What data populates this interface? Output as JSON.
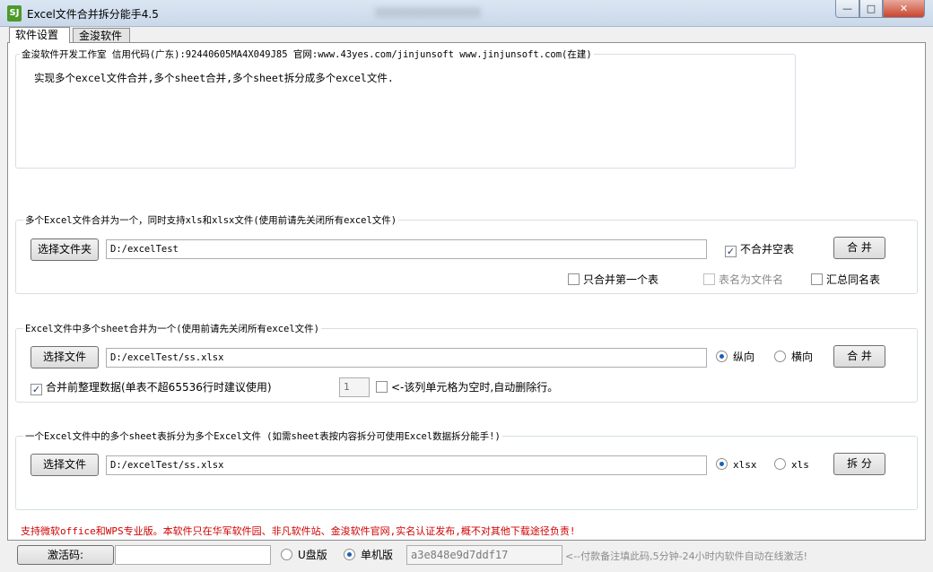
{
  "window": {
    "title": "Excel文件合并拆分能手4.5",
    "icon_text": "SJ",
    "min_symbol": "—",
    "max_symbol": "□",
    "close_symbol": "✕"
  },
  "tabs": [
    {
      "label": "软件设置",
      "active": true
    },
    {
      "label": "金浚软件",
      "active": false
    }
  ],
  "info": {
    "header": "金浚软件开发工作室 信用代码(广东):92440605MA4X049J85 官网:www.43yes.com/jinjunsoft  www.jinjunsoft.com(在建)",
    "description": "实现多个excel文件合并,多个sheet合并,多个sheet拆分成多个excel文件."
  },
  "merge_files": {
    "title": "多个Excel文件合并为一个，同时支持xls和xlsx文件(使用前请先关闭所有excel文件)",
    "choose_label": "选择文件夹",
    "path": "D:/excelTest",
    "skip_empty_label": "不合并空表",
    "skip_empty_checked": true,
    "merge_label": "合 并",
    "first_only_label": "只合并第一个表",
    "first_only_checked": false,
    "sheet_as_name_label": "表名为文件名",
    "sheet_as_name_checked": false,
    "sheet_as_name_enabled": false,
    "summary_label": "汇总同名表",
    "summary_checked": false
  },
  "merge_sheets": {
    "title": "Excel文件中多个sheet合并为一个(使用前请先关闭所有excel文件)",
    "choose_label": "选择文件",
    "path": "D:/excelTest/ss.xlsx",
    "vertical_label": "纵向",
    "horizontal_label": "横向",
    "orientation": "vertical",
    "merge_label": "合 并",
    "organize_label": "合并前整理数据(单表不超65536行时建议使用)",
    "organize_checked": true,
    "column_value": "1",
    "delete_row_label": "<-该列单元格为空时,自动删除行。",
    "delete_row_checked": false
  },
  "split_sheets": {
    "title": "一个Excel文件中的多个sheet表拆分为多个Excel文件 (如需sheet表按内容拆分可使用Excel数据拆分能手!)",
    "choose_label": "选择文件",
    "path": "D:/excelTest/ss.xlsx",
    "xlsx_label": "xlsx",
    "xls_label": "xls",
    "format": "xlsx",
    "split_label": "拆 分"
  },
  "notice": "支持微软office和WPS专业版。本软件只在华军软件园、非凡软件站、金浚软件官网,实名认证发布,概不对其他下载途径负责!",
  "activation": {
    "button_label": "激活码:",
    "code_value": "",
    "usb_label": "U盘版",
    "standalone_label": "单机版",
    "edition": "standalone",
    "machine_code": "a3e848e9d7ddf17",
    "hint": "<--付款备注填此码,5分钟-24小时内软件自动在线激活!"
  },
  "colors": {
    "notice_red": "#d00000",
    "group_border": "#d5dfe5",
    "radio_dot": "#1d5fb3"
  }
}
